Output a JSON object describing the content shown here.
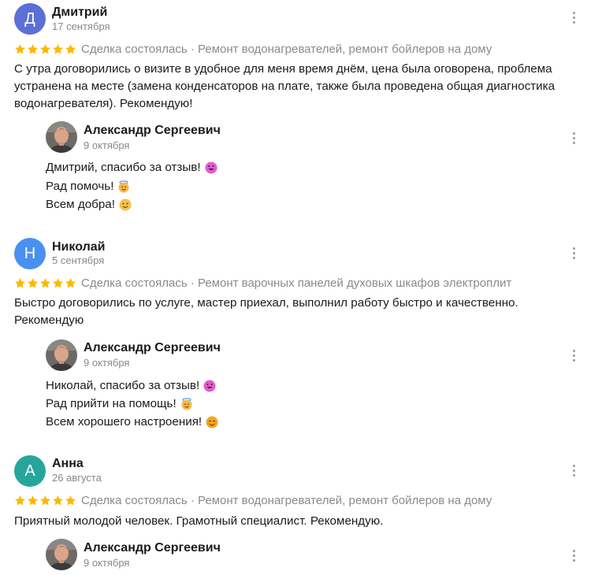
{
  "colors": {
    "star": "#fcb900",
    "avatar_d": "#5b6fd6",
    "avatar_n": "#4a90f0",
    "avatar_a": "#26a69a"
  },
  "reviews": [
    {
      "initial": "Д",
      "author": "Дмитрий",
      "date": "17 сентября",
      "rating": 5,
      "deal": "Сделка состоялась · Ремонт водонагревателей, ремонт бойлеров на дому",
      "text_lines": [
        "С утра договорились о визите в удобное для меня время днём, цена была оговорена, проблема",
        "устранена на месте (замена конденсаторов на плате, также была проведена общая диагностика",
        "водонагревателя). Рекомендую!"
      ],
      "reply": {
        "author": "Александр Сергеевич",
        "date": "9 октября",
        "lines": [
          "Дмитрий, спасибо за отзыв!",
          "Рад помочь!",
          "Всем добра!"
        ],
        "emojis": [
          "grinning-face-icon",
          "smiling-face-with-halo-icon",
          "slightly-smiling-face-icon"
        ]
      }
    },
    {
      "initial": "Н",
      "author": "Николай",
      "date": "5 сентября",
      "rating": 5,
      "deal": "Сделка состоялась · Ремонт варочных панелей духовых шкафов электроплит",
      "text_lines": [
        "Быстро договорились по услуге, мастер приехал, выполнил работу быстро и качественно.",
        "Рекомендую"
      ],
      "reply": {
        "author": "Александр Сергеевич",
        "date": "9 октября",
        "lines": [
          "Николай, спасибо за отзыв!",
          "Рад прийти на помощь!",
          "Всем хорошего настроения!"
        ],
        "emojis": [
          "grinning-face-icon",
          "smiling-face-with-halo-icon",
          "smiling-face-with-smiling-eyes-icon"
        ]
      }
    },
    {
      "initial": "А",
      "author": "Анна",
      "date": "26 августа",
      "rating": 5,
      "deal": "Сделка состоялась · Ремонт водонагревателей, ремонт бойлеров на дому",
      "text_lines": [
        "Приятный молодой человек. Грамотный специалист. Рекомендую."
      ],
      "reply": {
        "author": "Александр Сергеевич",
        "date": "9 октября"
      }
    }
  ]
}
